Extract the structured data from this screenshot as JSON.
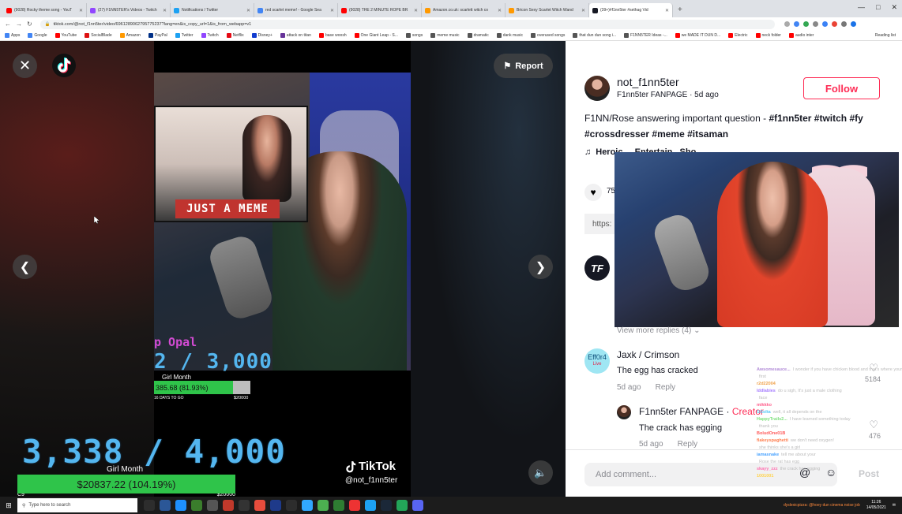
{
  "browser": {
    "tabs": [
      {
        "title": "(9028) Rocky theme song - YouT",
        "color": "#ff0000"
      },
      {
        "title": "(27) F1NN5TER's Videos - Twitch",
        "color": "#9146ff"
      },
      {
        "title": "Notifications / Twitter",
        "color": "#1da1f2"
      },
      {
        "title": "red scarlet meme! - Google Sea",
        "color": "#4285f4"
      },
      {
        "title": "(9028) THE 2 MINUTE ROPE BR",
        "color": "#ff0000"
      },
      {
        "title": "Amazon.co.uk: scarlett witch co",
        "color": "#ff9900"
      },
      {
        "title": "Bricon Sexy Scarlet Witch Wand",
        "color": "#ff9900"
      },
      {
        "title": "(39+)#f1nn5ter #sethag Vid",
        "color": "#161823"
      }
    ],
    "new_tab": "+",
    "url": "tiktok.com/@not_f1nn5ter/video/6961289062795775237?lang=en&is_copy_url=1&is_from_webapp=v1",
    "bookmarks": [
      {
        "label": "Apps",
        "color": "#4285f4"
      },
      {
        "label": "Google",
        "color": "#4285f4"
      },
      {
        "label": "YouTube",
        "color": "#ff0000"
      },
      {
        "label": "SocialBlade",
        "color": "#d11"
      },
      {
        "label": "Amazon",
        "color": "#ff9900"
      },
      {
        "label": "PayPal",
        "color": "#003087"
      },
      {
        "label": "Twitter",
        "color": "#1da1f2"
      },
      {
        "label": "Twitch",
        "color": "#9146ff"
      },
      {
        "label": "Netflix",
        "color": "#e50914"
      },
      {
        "label": "Disney+",
        "color": "#113ccf"
      },
      {
        "label": "attack on titan",
        "color": "#663399"
      },
      {
        "label": "base woosh",
        "color": "#ff0000"
      },
      {
        "label": "One Giant Leap - S...",
        "color": "#ff0000"
      },
      {
        "label": "songs",
        "color": "#555"
      },
      {
        "label": "meme music",
        "color": "#555"
      },
      {
        "label": "dramatic",
        "color": "#555"
      },
      {
        "label": "dank music",
        "color": "#555"
      },
      {
        "label": "overused songs",
        "color": "#555"
      },
      {
        "label": "that dun dun song i...",
        "color": "#555"
      },
      {
        "label": "F1NN5TER Ideas -...",
        "color": "#555"
      },
      {
        "label": "we MADE IT DUN D...",
        "color": "#ff0000"
      },
      {
        "label": "Electric",
        "color": "#ff0000"
      },
      {
        "label": "neck folder",
        "color": "#ff0000"
      },
      {
        "label": "audio inter",
        "color": "#ff0000"
      }
    ],
    "reading_list": "Reading list",
    "extension_colors": [
      "#aaa",
      "#4285f4",
      "#34a853",
      "#888",
      "#3b82f6",
      "#ea4335",
      "#777",
      "#1a73e8"
    ]
  },
  "video": {
    "report_label": "Report",
    "inset_banner": "JUST A MEME",
    "small_overlay": {
      "name_fragment": "p Opal",
      "count": "2 / 3,000",
      "subtitle": "Girl Month",
      "bar_text": "385.68 (81.93%)",
      "bar_fraction": 0.82,
      "days": "16 DAYS TO GO",
      "goal": "$20000"
    },
    "big_overlay": {
      "count": "3,338 / 4,000",
      "subtitle": "Girl Month",
      "bar_text": "$20837.22 (104.19%)",
      "bar_fraction": 1.0,
      "low_left": "C9",
      "low_right": "$20000"
    },
    "watermark_brand": "TikTok",
    "watermark_handle": "@not_f1nn5ter"
  },
  "post": {
    "username": "not_f1nn5ter",
    "fanpage_line": "F1nn5ter FANPAGE · 5d ago",
    "follow_label": "Follow",
    "description_plain": "F1NN/Rose answering important question - ",
    "tags": "#f1nn5ter #twitch #fy #crossdresser #meme #itsaman",
    "music": "Heroic",
    "music_suffix": "...Entertain...Sho...",
    "like_count": "75",
    "link_prefix": "https:"
  },
  "comments": {
    "first_avatar": "TF",
    "view_more": "View more replies (4)",
    "c2": {
      "avatar_text": "Eff0r4",
      "avatar_live": "Live",
      "name": "Jaxk / Crimson",
      "text": "The egg has cracked",
      "date": "5d ago",
      "reply": "Reply",
      "likes": "5184"
    },
    "r1": {
      "name": "F1nn5ter FANPAGE",
      "creator": "Creator",
      "text": "The crack has egging",
      "date": "5d ago",
      "reply": "Reply",
      "likes": "476"
    },
    "add_placeholder": "Add comment...",
    "post_label": "Post"
  },
  "chat": [
    {
      "name": "Awsomesauce...",
      "msg": "I wonder if you have chicken blood and that's where your",
      "color": "#b28cd8"
    },
    {
      "name": "",
      "msg": "first",
      "color": "#b28cd8"
    },
    {
      "name": "r2d22004",
      "msg": "",
      "color": "#f0a24a"
    },
    {
      "name": "lddlabies",
      "msg": "do u sigh, It's just a male clothing",
      "color": "#a57cff"
    },
    {
      "name": "",
      "msg": "face",
      "color": "#a57cff"
    },
    {
      "name": "mikkko",
      "msg": "",
      "color": "#ff5c8a"
    },
    {
      "name": "GSolta",
      "msg": "well, it all depends on the",
      "color": "#5bc8f5"
    },
    {
      "name": "HappyTrails2...",
      "msg": "I have learned something today",
      "color": "#7fe07f"
    },
    {
      "name": "",
      "msg": "thank you",
      "color": "#7fe07f"
    },
    {
      "name": "BoludOne01B",
      "msg": "",
      "color": "#ff5a5a"
    },
    {
      "name": "flakeyspaghetti",
      "msg": "we don't need oxygen!",
      "color": "#ff7f50"
    },
    {
      "name": "",
      "msg": "she thinks she's a girl",
      "color": "#ff7f50"
    },
    {
      "name": "iamasnake",
      "msg": "tell me about your",
      "color": "#4aa3ff"
    },
    {
      "name": "",
      "msg": "Rose the rat has egg",
      "color": "#4aa3ff"
    },
    {
      "name": "skayy_zzz",
      "msg": "the crack has egging",
      "color": "#ff70b0"
    },
    {
      "name": "1001001",
      "msg": "",
      "color": "#ffd24a"
    }
  ],
  "taskbar": {
    "start": "⊞",
    "search_placeholder": "Type here to search",
    "icon_colors": [
      "#2d2d2d",
      "#2b5797",
      "#1e90ff",
      "#3a7d2c",
      "#555",
      "#c0392b",
      "#333",
      "#e74c3c",
      "#1e3a8a",
      "#2d2d2d",
      "#31a8ff",
      "#4caf50",
      "#2e7d32",
      "#e33",
      "#1da1f2",
      "#1b2838",
      "#23a559",
      "#5865f2"
    ],
    "ticker": "dyslexicpizza: @hoey dun cinema noise job",
    "time": "11:26",
    "date": "14/05/2021"
  }
}
